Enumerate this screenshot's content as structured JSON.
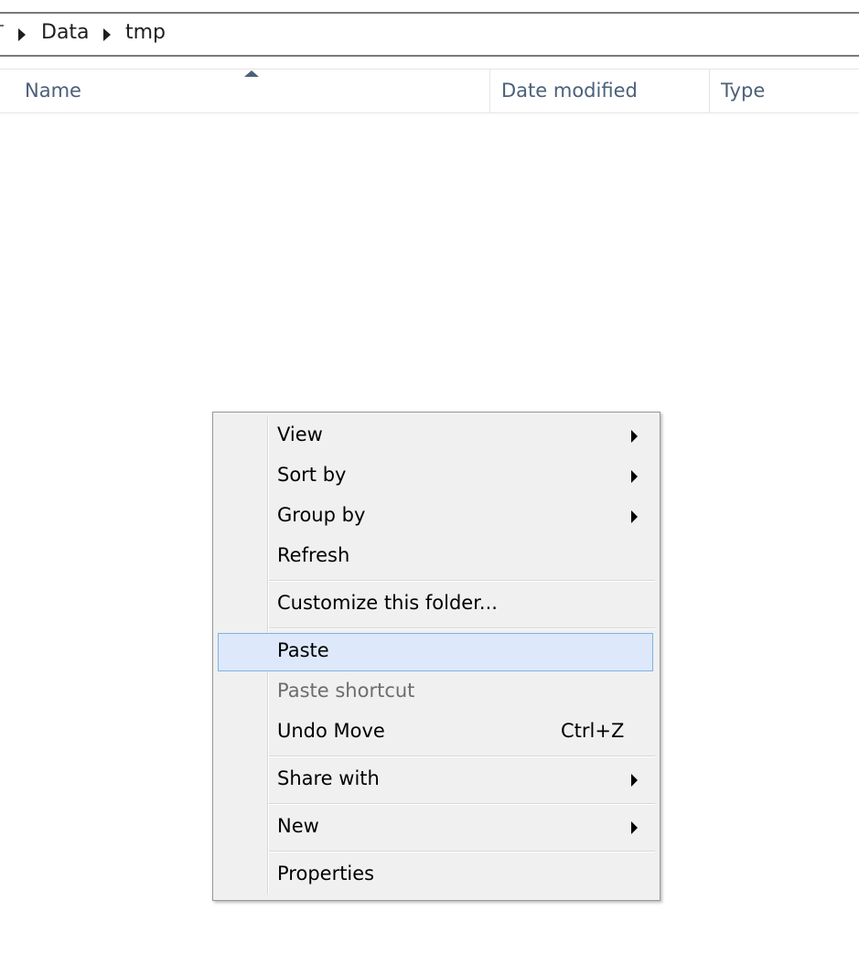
{
  "breadcrumb": {
    "items": [
      "Data",
      "tmp"
    ]
  },
  "columns": {
    "name": "Name",
    "date_modified": "Date modified",
    "type": "Type",
    "sorted_by": "Name",
    "sort_direction": "ascending"
  },
  "context_menu": {
    "items": [
      {
        "label": "View",
        "submenu": true
      },
      {
        "label": "Sort by",
        "submenu": true
      },
      {
        "label": "Group by",
        "submenu": true
      },
      {
        "label": "Refresh",
        "submenu": false
      },
      {
        "label": "Customize this folder...",
        "submenu": false
      },
      {
        "label": "Paste",
        "submenu": false,
        "highlighted": true
      },
      {
        "label": "Paste shortcut",
        "submenu": false,
        "disabled": true
      },
      {
        "label": "Undo Move",
        "shortcut": "Ctrl+Z",
        "submenu": false
      },
      {
        "label": "Share with",
        "submenu": true
      },
      {
        "label": "New",
        "submenu": true
      },
      {
        "label": "Properties",
        "submenu": false
      }
    ]
  },
  "colors": {
    "highlight_bg": "#dde9fa",
    "highlight_border": "#7fb2e7",
    "header_text": "#4c607a",
    "menu_bg": "#f0f0f0"
  }
}
